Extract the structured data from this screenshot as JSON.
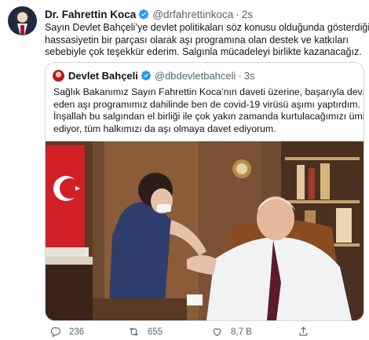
{
  "tweet": {
    "author_name": "Dr. Fahrettin Koca",
    "author_handle": "@drfahrettinkoca",
    "separator": "·",
    "time": "2s",
    "text_lines": [
      "Sayın Devlet Bahçeli’ye devlet politikaları söz konusu olduğunda gösterdiği",
      "hassasiyetin bir parçası olarak aşı programına olan destek ve katkıları",
      "sebebiyle çok teşekkür ederim. Salgınla mücadeleyi birlikte kazanacağız."
    ]
  },
  "quote": {
    "author_name": "Devlet Bahçeli",
    "author_handle": "@dbdevletbahceli",
    "separator": "·",
    "time": "3s",
    "text_lines": [
      "Sağlık Bakanımız Sayın Fahrettin Koca’nın daveti üzerine, başarıyla devam",
      "eden aşı programımız dahilinde ben de covid-19 virüsü aşımı yaptırdım.",
      "İnşallah bu salgından el birliği ile çok yakın zamanda kurtulacağımızı ümit",
      "ediyor, tüm halkımızı da aşı olmaya davet ediyorum."
    ]
  },
  "actions": {
    "replies": "236",
    "retweets": "655",
    "likes": "8,7 B"
  },
  "colors": {
    "verified": "#1d9bf0",
    "text_primary": "#0f1419",
    "text_secondary": "#536471",
    "border": "#cfd9de"
  },
  "icons": [
    "verified-badge-icon",
    "reply-icon",
    "retweet-icon",
    "like-icon",
    "share-icon"
  ]
}
